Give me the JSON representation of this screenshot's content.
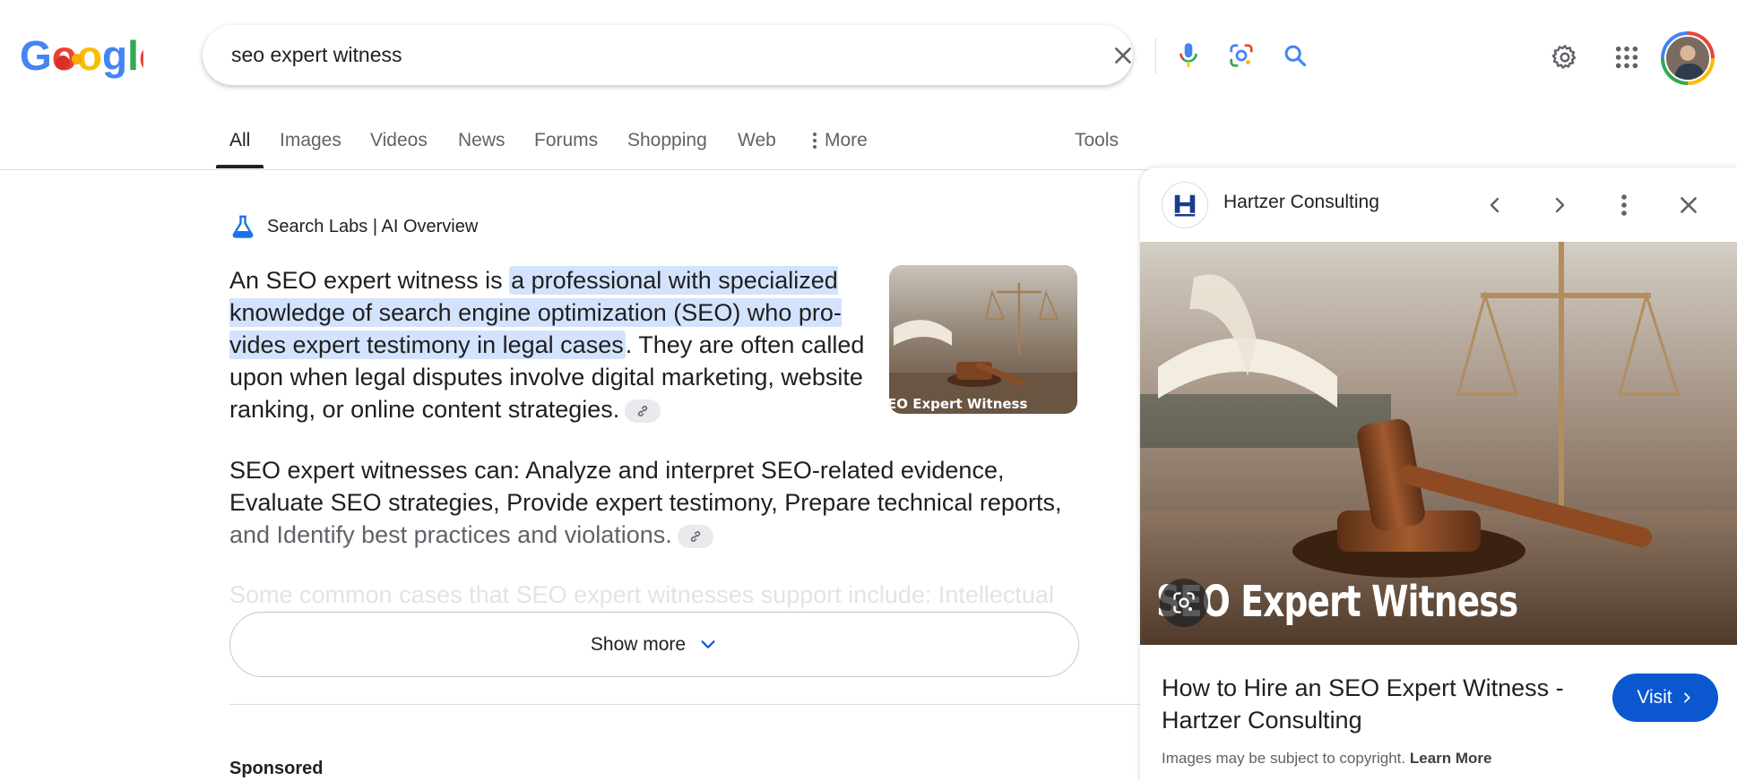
{
  "search": {
    "query": "seo expert witness"
  },
  "tabs": [
    {
      "label": "All"
    },
    {
      "label": "Images"
    },
    {
      "label": "Videos"
    },
    {
      "label": "News"
    },
    {
      "label": "Forums"
    },
    {
      "label": "Shopping"
    },
    {
      "label": "Web"
    },
    {
      "label": "More"
    },
    {
      "label": "Tools"
    }
  ],
  "ai": {
    "heading": "Search Labs | AI Overview",
    "p1_before": "An SEO expert witness is ",
    "p1_highlight": "a professional with specialized knowledge of search engine optimization (SEO) who pro­vides expert testimony in legal cases",
    "p1_after": ". They are often called upon when legal disputes involve digital marketing, website ranking, or online content strategies.",
    "p2_main": "SEO expert witnesses can: Analyze and interpret SEO-related evidence, Evaluate SEO strategies, Provide expert testimony, Prepare technical reports,",
    "p2_fade": "and Identify best practices and violations.",
    "p3": "Some common cases that SEO expert witnesses support include: Intellectual",
    "thumb_caption": "EO Expert Witness",
    "show_more": "Show more"
  },
  "sponsored": "Sponsored",
  "panel": {
    "site_name": "Hartzer Consulting",
    "image_caption": "SEO Expert Witness",
    "title": "How to Hire an SEO Expert Witness - Hartzer Consulting",
    "visit_label": "Visit",
    "copyright": "Images may be subject to copyright.",
    "learn_more": "Learn More"
  },
  "colors": {
    "accent": "#0b57d0",
    "highlight": "#d3e3fd"
  }
}
